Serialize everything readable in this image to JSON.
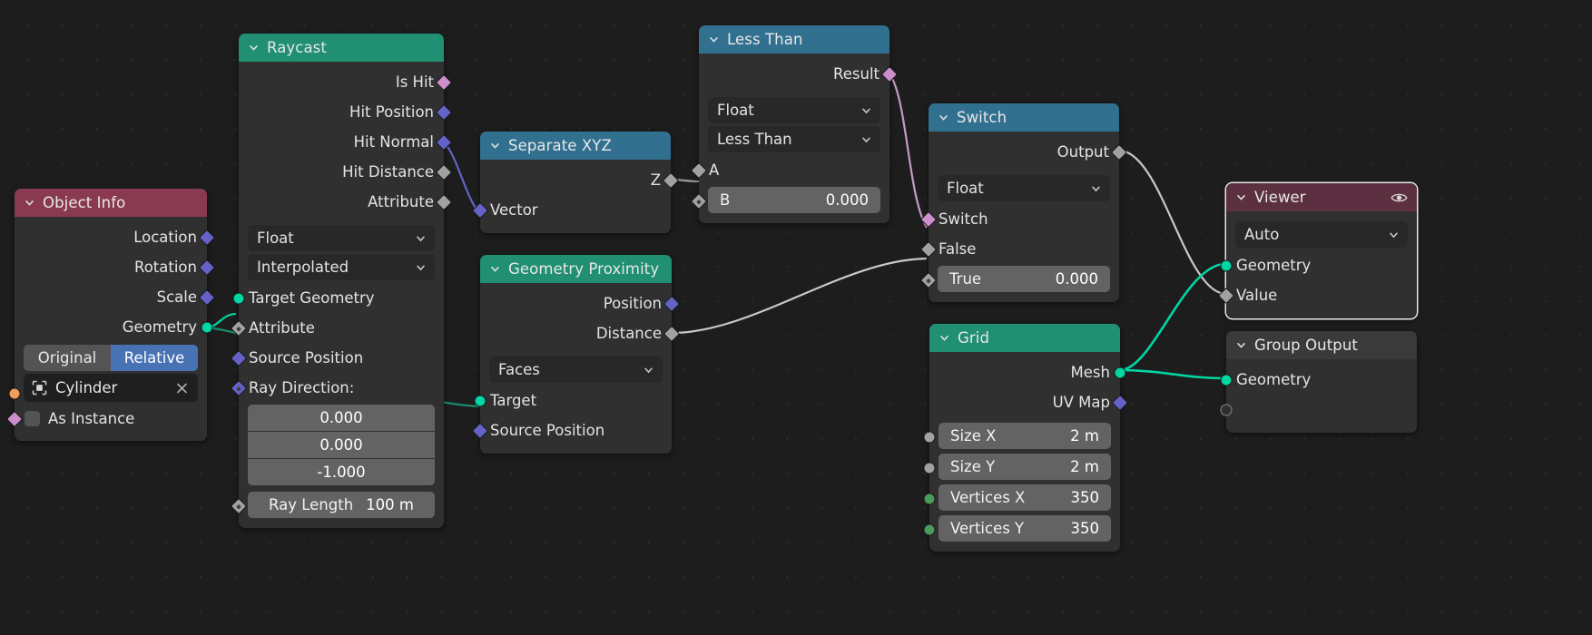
{
  "editor": {
    "name": "blender-geometry-node-editor",
    "background": "#1d1d1d"
  },
  "colors": {
    "header_geometry": "#208f72",
    "header_converter": "#32708f",
    "header_input": "#8a3a50",
    "header_output": "#4a2a33",
    "socket_geometry": "#00d6a3",
    "socket_vector": "#6363c7",
    "socket_float": "#a1a1a1",
    "socket_boolean": "#cc8fcc",
    "socket_object": "#ed9e5c",
    "socket_int": "#598c5c",
    "accent_blue": "#4772b3"
  },
  "nodes": {
    "object_info": {
      "title": "Object Info",
      "outputs": [
        {
          "label": "Location",
          "socket": "vector"
        },
        {
          "label": "Rotation",
          "socket": "vector"
        },
        {
          "label": "Scale",
          "socket": "vector"
        },
        {
          "label": "Geometry",
          "socket": "geometry"
        }
      ],
      "transform_toggle": {
        "options": [
          "Original",
          "Relative"
        ],
        "selected": "Relative"
      },
      "object_field": {
        "value": "Cylinder",
        "icon": "object-icon",
        "clear": "×"
      },
      "as_instance": {
        "label": "As Instance",
        "checked": false
      }
    },
    "raycast": {
      "title": "Raycast",
      "outputs": [
        {
          "label": "Is Hit",
          "socket": "boolean"
        },
        {
          "label": "Hit Position",
          "socket": "vector"
        },
        {
          "label": "Hit Normal",
          "socket": "vector"
        },
        {
          "label": "Hit Distance",
          "socket": "float"
        },
        {
          "label": "Attribute",
          "socket": "float"
        }
      ],
      "data_type": "Float",
      "mapping": "Interpolated",
      "inputs": [
        {
          "label": "Target Geometry",
          "socket": "geometry"
        },
        {
          "label": "Attribute",
          "socket": "float"
        },
        {
          "label": "Source Position",
          "socket": "vector"
        },
        {
          "label": "Ray Direction:",
          "socket": "vector"
        }
      ],
      "ray_direction": [
        "0.000",
        "0.000",
        "-1.000"
      ],
      "ray_length": {
        "label": "Ray Length",
        "value": "100 m"
      }
    },
    "separate_xyz": {
      "title": "Separate XYZ",
      "outputs": [
        {
          "label": "Z",
          "socket": "float"
        }
      ],
      "inputs": [
        {
          "label": "Vector",
          "socket": "vector"
        }
      ]
    },
    "geometry_proximity": {
      "title": "Geometry Proximity",
      "outputs": [
        {
          "label": "Position",
          "socket": "vector"
        },
        {
          "label": "Distance",
          "socket": "float"
        }
      ],
      "target_element": "Faces",
      "inputs": [
        {
          "label": "Target",
          "socket": "geometry"
        },
        {
          "label": "Source Position",
          "socket": "vector"
        }
      ]
    },
    "less_than": {
      "title": "Less Than",
      "outputs": [
        {
          "label": "Result",
          "socket": "boolean"
        }
      ],
      "data_type": "Float",
      "operation": "Less Than",
      "inputs": [
        {
          "label": "A",
          "socket": "float"
        },
        {
          "label": "B",
          "socket": "float",
          "value": "0.000"
        }
      ]
    },
    "switch": {
      "title": "Switch",
      "outputs": [
        {
          "label": "Output",
          "socket": "float"
        }
      ],
      "data_type": "Float",
      "inputs": [
        {
          "label": "Switch",
          "socket": "boolean"
        },
        {
          "label": "False",
          "socket": "float"
        },
        {
          "label": "True",
          "socket": "float",
          "value": "0.000"
        }
      ]
    },
    "grid": {
      "title": "Grid",
      "outputs": [
        {
          "label": "Mesh",
          "socket": "geometry"
        },
        {
          "label": "UV Map",
          "socket": "vector"
        }
      ],
      "inputs": [
        {
          "label": "Size X",
          "value": "2 m",
          "socket": "float"
        },
        {
          "label": "Size Y",
          "value": "2 m",
          "socket": "float"
        },
        {
          "label": "Vertices X",
          "value": "350",
          "socket": "int"
        },
        {
          "label": "Vertices Y",
          "value": "350",
          "socket": "int"
        }
      ]
    },
    "viewer": {
      "title": "Viewer",
      "eye_icon": "eye-icon",
      "domain": "Auto",
      "inputs": [
        {
          "label": "Geometry",
          "socket": "geometry"
        },
        {
          "label": "Value",
          "socket": "float"
        }
      ]
    },
    "group_output": {
      "title": "Group Output",
      "inputs": [
        {
          "label": "Geometry",
          "socket": "geometry"
        },
        {
          "label": "",
          "socket": "empty"
        }
      ]
    }
  }
}
